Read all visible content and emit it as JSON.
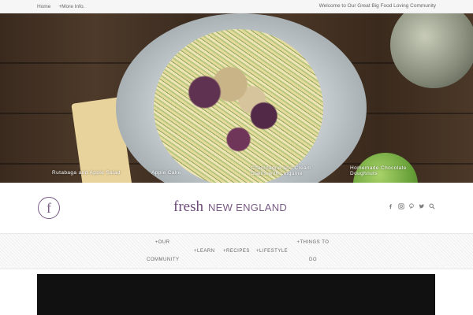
{
  "topbar": {
    "nav": [
      {
        "label": "Home"
      },
      {
        "label": "+More Info."
      }
    ],
    "welcome": "Welcome to Our Great Big Food Loving Community"
  },
  "hero": {
    "captions": [
      {
        "label": "Rutabaga and Apple Salad"
      },
      {
        "label": "Apple Cake"
      },
      {
        "label": "Champagne and Cream Clams with Linguine"
      },
      {
        "label": "Homemade Chocolate Doughnuts"
      }
    ]
  },
  "header": {
    "logo_letter": "f",
    "wordmark_1": "fresh",
    "wordmark_2": "NEW ENGLAND",
    "social_icons": [
      "facebook-icon",
      "instagram-icon",
      "pinterest-icon",
      "twitter-icon",
      "search-icon"
    ],
    "accent_color": "#7a5b85"
  },
  "nav": {
    "items": [
      {
        "label": "+OUR COMMUNITY"
      },
      {
        "label": "+LEARN"
      },
      {
        "label": "+RECIPES"
      },
      {
        "label": "+LIFESTYLE"
      },
      {
        "label": "+THINGS TO DO"
      }
    ]
  }
}
